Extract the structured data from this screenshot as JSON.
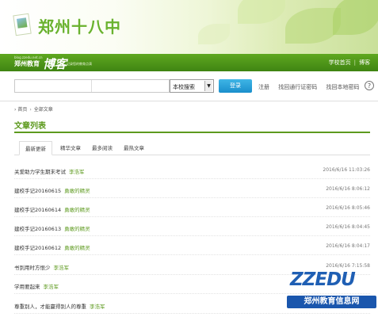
{
  "colors": {
    "brand_green": "#5d9a1e",
    "nav_green": "#4d961a",
    "search_button_blue": "#1a8fcc",
    "author_link_green": "#5d9a1e",
    "watermark_blue": "#1a56ad"
  },
  "header": {
    "school_name": "郑州十八中",
    "logo_icon": "school-logo-icon"
  },
  "navbar": {
    "brand_domain": "blog.zzedu.net.cn",
    "brand_name": "郑州教育",
    "brand_blog": "博客",
    "brand_slogan": "记录您的教育点滴",
    "links": [
      "学校首页",
      "博客"
    ]
  },
  "search": {
    "scope_selected": "本校搜索",
    "button_label": "登录",
    "quick_links": [
      "注册",
      "找回通行证密码",
      "找回本地密码"
    ],
    "help_icon": "help-icon"
  },
  "breadcrumb": {
    "home": "首页",
    "current": "全部文章"
  },
  "page_title": "文章列表",
  "tabs": [
    "最新更新",
    "精华文章",
    "最多阅读",
    "最热文章"
  ],
  "articles": [
    {
      "title": "关爱助力学生期末考试",
      "author": "李浩军",
      "date": "2016/6/16 11:03:26"
    },
    {
      "title": "建校手记20160615",
      "author": "勇敢的精灵",
      "date": "2016/6/16 8:06:12"
    },
    {
      "title": "建校手记20160614",
      "author": "勇敢的精灵",
      "date": "2016/6/16 8:05:46"
    },
    {
      "title": "建校手记20160613",
      "author": "勇敢的精灵",
      "date": "2016/6/16 8:04:45"
    },
    {
      "title": "建校手记20160612",
      "author": "勇敢的精灵",
      "date": "2016/6/16 8:04:17"
    },
    {
      "title": "书到用时方恨少",
      "author": "李浩军",
      "date": "2016/6/16 7:15:58"
    },
    {
      "title": "学用要起来",
      "author": "李浩军",
      "date": ""
    },
    {
      "title": "尊重别人，才能赢得别人的尊重",
      "author": "李浩军",
      "date": ""
    }
  ],
  "watermark": {
    "logo": "ZZEDU",
    "text": "郑州教育信息网"
  }
}
